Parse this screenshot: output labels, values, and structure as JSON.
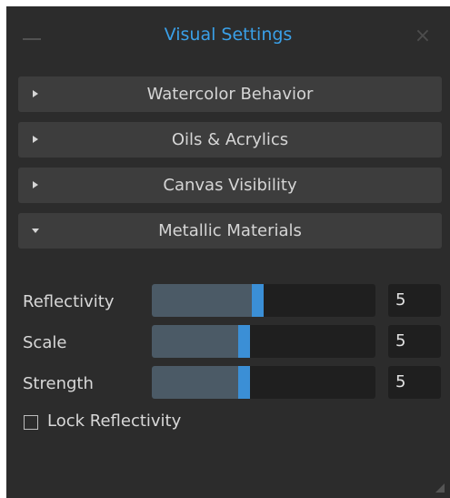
{
  "panel": {
    "title": "Visual Settings",
    "accent_color": "#3aa0e8",
    "icons": {
      "minimize": "minimize-icon",
      "close": "close-icon"
    },
    "close_glyph": "×"
  },
  "sections": [
    {
      "label": "Watercolor Behavior",
      "expanded": false
    },
    {
      "label": "Oils & Acrylics",
      "expanded": false
    },
    {
      "label": "Canvas Visibility",
      "expanded": false
    },
    {
      "label": "Metallic Materials",
      "expanded": true
    }
  ],
  "parameters": [
    {
      "label": "Reflectivity",
      "value": "5",
      "fill_fraction": 0.5
    },
    {
      "label": "Scale",
      "value": "5",
      "fill_fraction": 0.44
    },
    {
      "label": "Strength",
      "value": "5",
      "fill_fraction": 0.44
    }
  ],
  "lock_checkbox": {
    "label": "Lock Reflectivity",
    "checked": false
  },
  "colors": {
    "panel_bg": "#2c2c2c",
    "section_bg": "#3d3d3d",
    "slider_fill": "#4b5a66",
    "slider_handle": "#3b8fd6"
  }
}
